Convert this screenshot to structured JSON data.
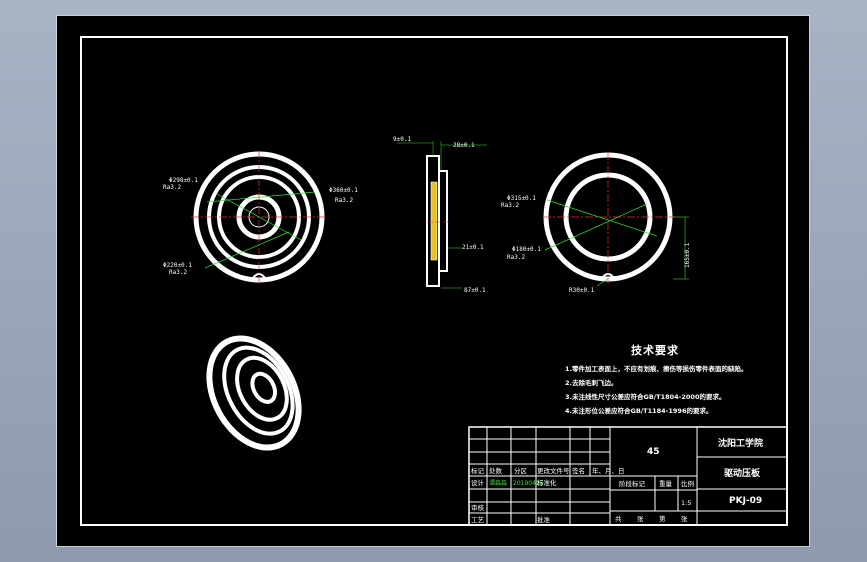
{
  "drawing": {
    "dimensions": {
      "front_outer": "Φ360±0.1",
      "front_inner": "Φ298±0.1",
      "front_bottom": "Φ220±0.1",
      "front_small1": "Ra3.2",
      "front_small2": "Ra3.2",
      "front_small3": "Ra3.2",
      "side_top_left": "9±0.1",
      "side_top_right": "28±0.1",
      "side_mid": "21±0.1",
      "side_bottom": "87±0.1",
      "right_outer": "Φ315±0.1",
      "right_inner": "Φ180±0.1",
      "right_vertical": "165±0.1",
      "right_slot": "R30±0.1",
      "right_small1": "Ra3.2",
      "right_small2": "Ra3.2"
    }
  },
  "requirements": {
    "title": "技术要求",
    "items": [
      "1.零件加工表面上，不应有划痕、擦伤等损伤零件表面的缺陷。",
      "2.去除毛刺飞边。",
      "3.未注线性尺寸公差应符合GB/T1804-2000的要求。",
      "4.未注形位公差应符合GB/T1184-1996的要求。"
    ]
  },
  "title_block": {
    "material": "45",
    "school": "沈阳工学院",
    "part_name": "驱动压板",
    "drawing_no": "PKJ-09",
    "scale": "1:5",
    "scale_label": "比例",
    "weight_label": "重量",
    "stage_label": "阶段标记",
    "sheet_labels": [
      "共",
      "张",
      "第",
      "张"
    ],
    "row_labels": [
      "标记",
      "处数",
      "分区",
      "更改文件号",
      "签名",
      "年、月、日"
    ],
    "design_label": "设计",
    "designer": "谭淼淼",
    "date": "20190415",
    "standard_label": "标准化",
    "review_label": "审核",
    "process_label": "工艺",
    "approve_label": "批准"
  }
}
